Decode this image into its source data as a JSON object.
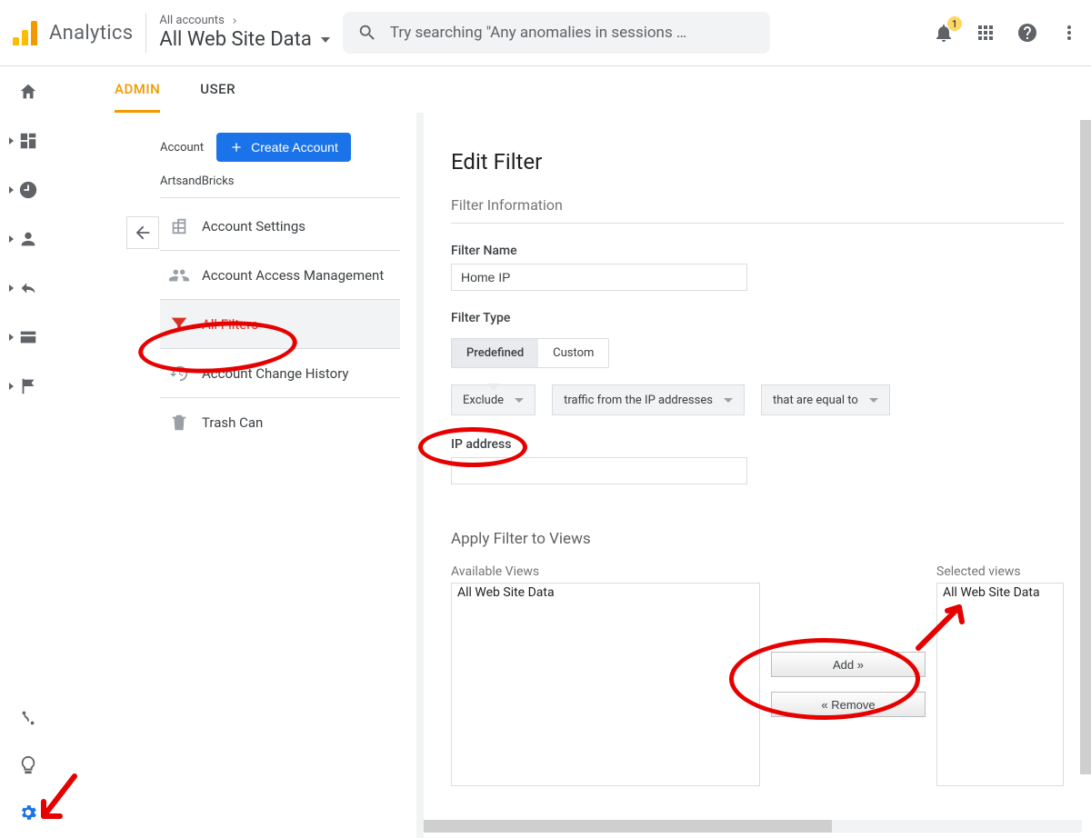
{
  "brand": "Analytics",
  "crumb": {
    "top": "All accounts",
    "title": "All Web Site Data"
  },
  "search": {
    "placeholder": "Try searching \"Any anomalies in sessions …"
  },
  "notifications": {
    "count": "1"
  },
  "tabs": {
    "admin": "ADMIN",
    "user": "USER"
  },
  "accountPanel": {
    "label": "Account",
    "createBtn": "Create Account",
    "accountName": "ArtsandBricks",
    "items": {
      "settings": "Account Settings",
      "access": "Account Access Management",
      "filters": "All Filters",
      "history": "Account Change History",
      "trash": "Trash Can"
    }
  },
  "editFilter": {
    "title": "Edit Filter",
    "infoHeading": "Filter Information",
    "nameLabel": "Filter Name",
    "nameValue": "Home IP",
    "typeLabel": "Filter Type",
    "typeOptions": {
      "predefined": "Predefined",
      "custom": "Custom"
    },
    "dd1": "Exclude",
    "dd2": "traffic from the IP addresses",
    "dd3": "that are equal to",
    "ipLabel": "IP address",
    "ipValue": ""
  },
  "applyViews": {
    "heading": "Apply Filter to Views",
    "availableLabel": "Available Views",
    "availableItem": "All Web Site Data",
    "selectedLabel": "Selected views",
    "selectedItem": "All Web Site Data",
    "addBtn": "Add »",
    "removeBtn": "« Remove"
  }
}
